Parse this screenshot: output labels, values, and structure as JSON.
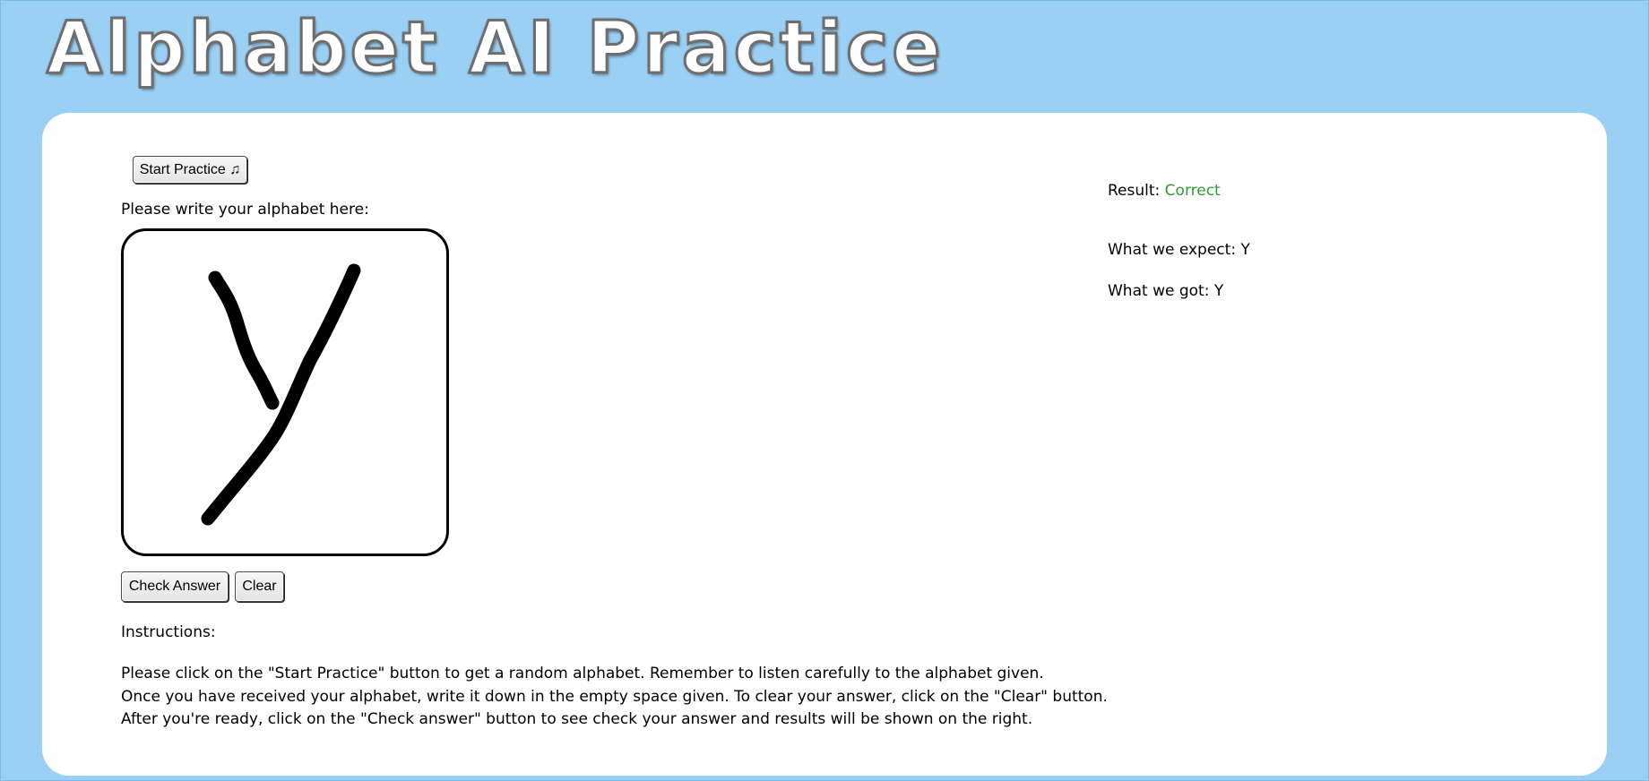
{
  "app": {
    "title": "Alphabet AI Practice"
  },
  "controls": {
    "start_label": "Start Practice ♫",
    "check_label": "Check Answer",
    "clear_label": "Clear"
  },
  "canvas": {
    "prompt": "Please write your alphabet here:",
    "drawn_letter": "Y"
  },
  "results": {
    "result_label": "Result:",
    "result_value": "Correct",
    "result_color": "#2f9a2f",
    "expect_label": "What we expect:",
    "expect_value": "Y",
    "got_label": "What we got:",
    "got_value": "Y"
  },
  "instructions": {
    "title": "Instructions:",
    "lines": [
      "Please click on the \"Start Practice\" button to get a random alphabet. Remember to listen carefully to the alphabet given.",
      "Once you have received your alphabet, write it down in the empty space given. To clear your answer, click on the \"Clear\" button.",
      "After you're ready, click on the \"Check answer\" button to see check your answer and results will be shown on the right."
    ]
  },
  "colors": {
    "background": "#9bd0f5",
    "panel": "#ffffff"
  }
}
